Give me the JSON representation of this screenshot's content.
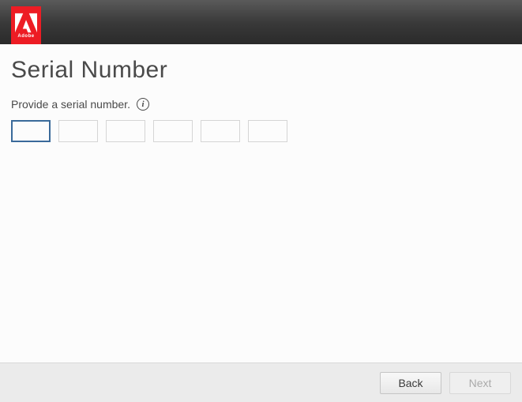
{
  "brand": {
    "name": "Adobe"
  },
  "title": "Serial Number",
  "prompt": "Provide a serial number.",
  "serial": {
    "fields": [
      "",
      "",
      "",
      "",
      "",
      ""
    ],
    "focused_index": 0
  },
  "buttons": {
    "back": "Back",
    "next": "Next"
  }
}
